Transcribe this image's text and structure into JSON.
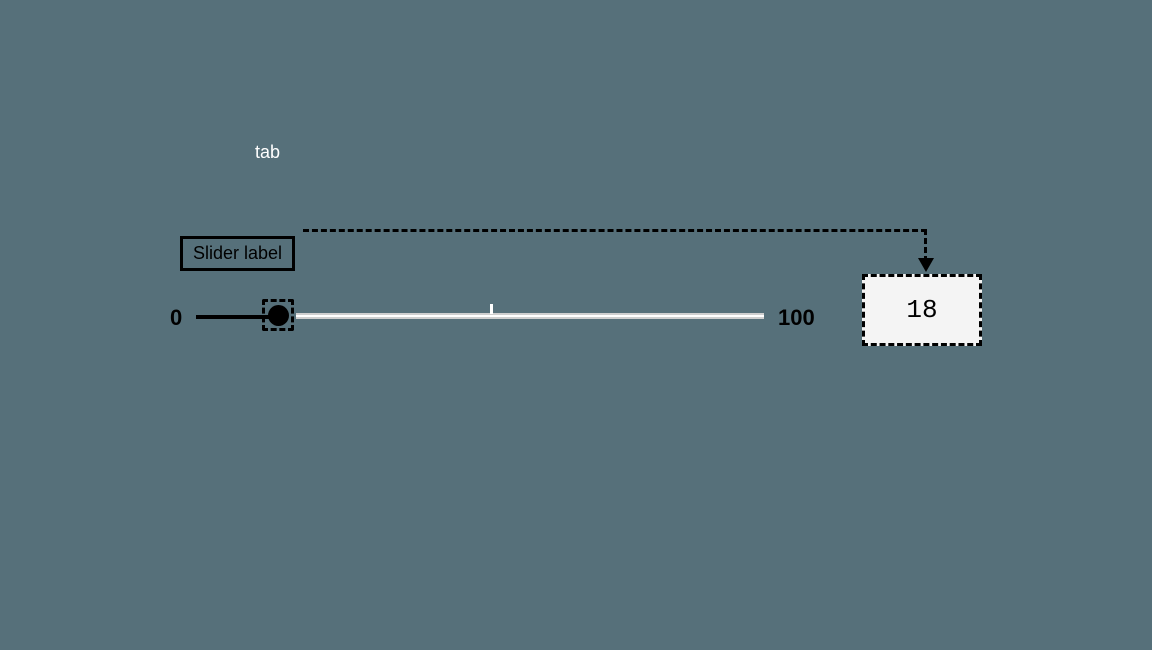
{
  "annotation": {
    "tab_key": "tab"
  },
  "slider": {
    "label": "Slider label",
    "min": "0",
    "max": "100",
    "value": "18"
  }
}
